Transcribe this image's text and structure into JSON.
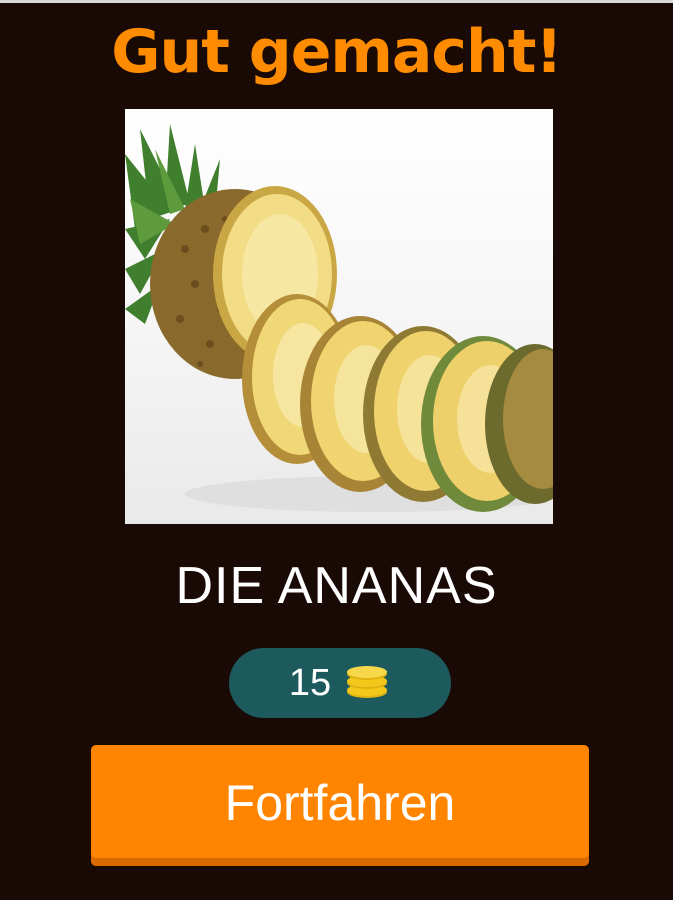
{
  "header": {
    "title": "Gut gemacht!"
  },
  "puzzle": {
    "image_subject": "pineapple-slices-photo",
    "answer": "DIE ANANAS"
  },
  "reward": {
    "coins": "15",
    "icon": "coin-stack-icon"
  },
  "actions": {
    "continue_label": "Fortfahren"
  },
  "colors": {
    "background": "#1a0a06",
    "title": "#ff8c00",
    "button": "#ff8400",
    "pill": "#1d5a5e",
    "coin": "#f2c81b"
  }
}
